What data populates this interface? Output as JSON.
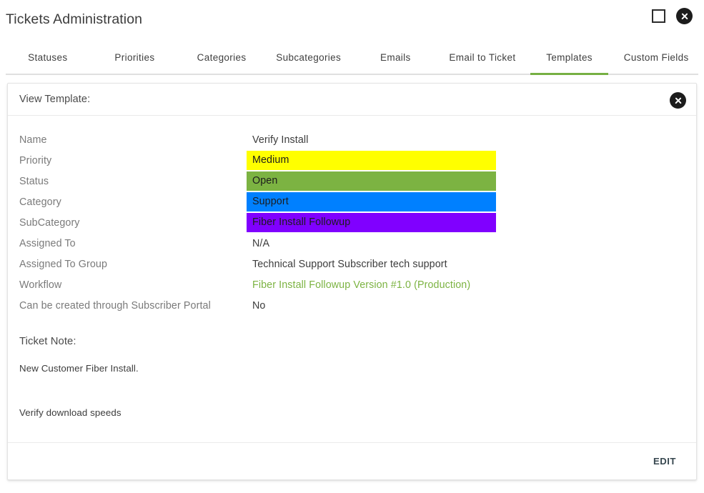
{
  "window": {
    "title": "Tickets Administration",
    "controls": {
      "maximize_name": "maximize-icon",
      "close_name": "close-icon"
    }
  },
  "tabs": [
    {
      "label": "Statuses",
      "active": false
    },
    {
      "label": "Priorities",
      "active": false
    },
    {
      "label": "Categories",
      "active": false
    },
    {
      "label": "Subcategories",
      "active": false
    },
    {
      "label": "Emails",
      "active": false
    },
    {
      "label": "Email to Ticket",
      "active": false
    },
    {
      "label": "Templates",
      "active": true
    },
    {
      "label": "Custom Fields",
      "active": false
    }
  ],
  "card": {
    "title": "View Template:",
    "fields": [
      {
        "label": "Name",
        "value": "Verify Install",
        "style": "plain"
      },
      {
        "label": "Priority",
        "value": "Medium",
        "style": "badge",
        "color": "#ffff00"
      },
      {
        "label": "Status",
        "value": "Open",
        "style": "badge",
        "color": "#7cb342"
      },
      {
        "label": "Category",
        "value": "Support",
        "style": "badge",
        "color": "#0080ff"
      },
      {
        "label": "SubCategory",
        "value": "Fiber Install Followup",
        "style": "badge",
        "color": "#8000ff"
      },
      {
        "label": "Assigned To",
        "value": "N/A",
        "style": "plain"
      },
      {
        "label": "Assigned To Group",
        "value": "Technical Support Subscriber tech support",
        "style": "plain"
      },
      {
        "label": "Workflow",
        "value": "Fiber Install Followup Version #1.0 (Production)",
        "style": "link"
      },
      {
        "label": "Can be created through Subscriber Portal",
        "value": "No",
        "style": "plain"
      }
    ],
    "note": {
      "title": "Ticket Note:",
      "line1": "New Customer Fiber Install.",
      "line2": "Verify download speeds"
    },
    "footer": {
      "edit_label": "EDIT"
    }
  },
  "colors": {
    "accent_green": "#76b043",
    "link_green": "#7cb342",
    "label_gray": "#7a7a7a",
    "text_dark": "#3c3c3c",
    "edit_dark": "#37474f"
  }
}
